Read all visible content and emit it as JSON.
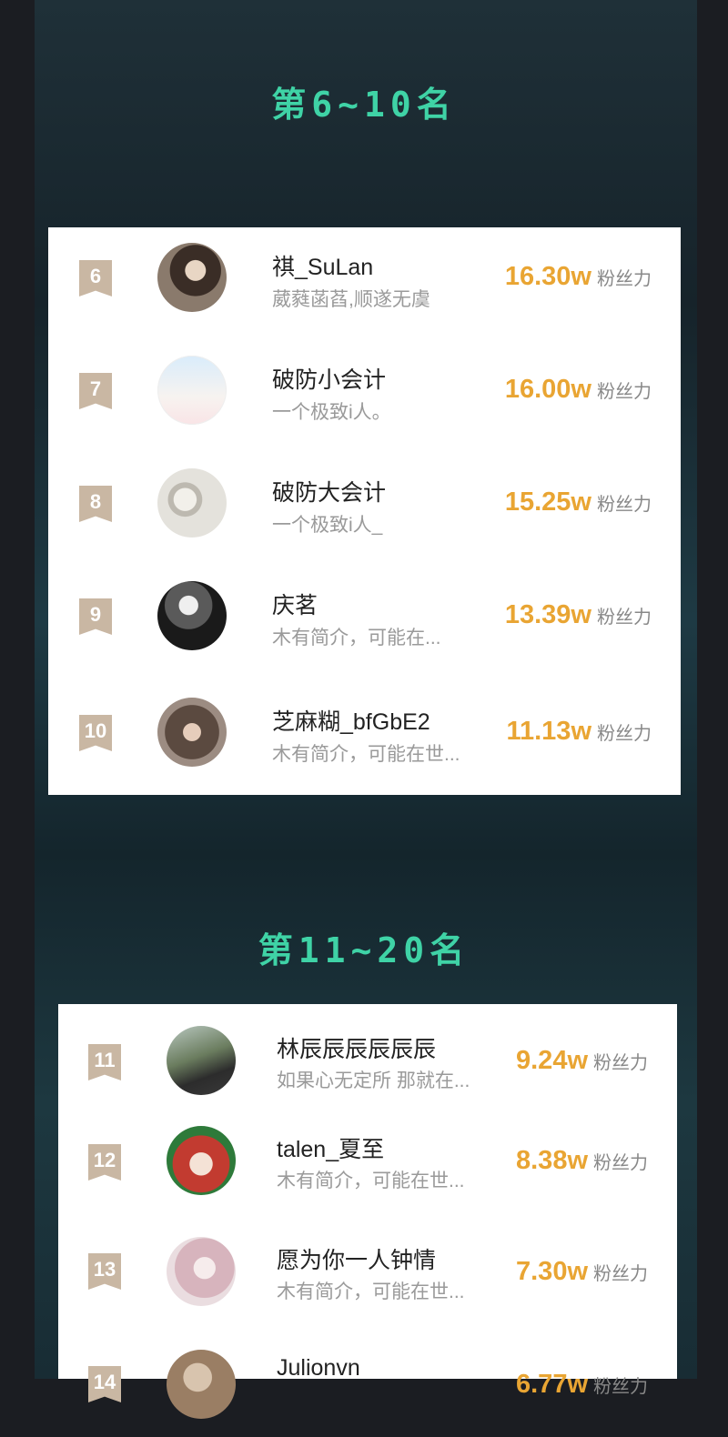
{
  "sections": [
    {
      "title": "第6~10名",
      "rows": [
        {
          "rank": "6",
          "name": "祺_SuLan",
          "bio": "葳蕤菡萏,顺遂无虞",
          "score": "16.30w",
          "unit": "粉丝力",
          "avatar_color": "#5a4a3e"
        },
        {
          "rank": "7",
          "name": "破防小会计",
          "bio": "一个极致i人。",
          "score": "16.00w",
          "unit": "粉丝力",
          "avatar_color": "#e6eef8"
        },
        {
          "rank": "8",
          "name": "破防大会计",
          "bio": "一个极致i人_",
          "score": "15.25w",
          "unit": "粉丝力",
          "avatar_color": "#cfcfca"
        },
        {
          "rank": "9",
          "name": "庆茗",
          "bio": "木有简介，可能在...",
          "score": "13.39w",
          "unit": "粉丝力",
          "avatar_color": "#2a2a2a"
        },
        {
          "rank": "10",
          "name": "芝麻糊_bfGbE2",
          "bio": "木有简介，可能在世...",
          "score": "11.13w",
          "unit": "粉丝力",
          "avatar_color": "#6b5a50"
        }
      ]
    },
    {
      "title": "第11~20名",
      "rows": [
        {
          "rank": "11",
          "name": "林辰辰辰辰辰辰",
          "bio": "如果心无定所 那就在...",
          "score": "9.24w",
          "unit": "粉丝力",
          "avatar_color": "#4a5a44"
        },
        {
          "rank": "12",
          "name": "talen_夏至",
          "bio": "木有简介，可能在世...",
          "score": "8.38w",
          "unit": "粉丝力",
          "avatar_color": "#b8392f"
        },
        {
          "rank": "13",
          "name": "愿为你一人钟情",
          "bio": "木有简介，可能在世...",
          "score": "7.30w",
          "unit": "粉丝力",
          "avatar_color": "#e4c9cf"
        },
        {
          "rank": "14",
          "name": "Julionvn",
          "bio": "",
          "score": "6.77w",
          "unit": "粉丝力",
          "avatar_color": "#a08468"
        }
      ]
    }
  ]
}
